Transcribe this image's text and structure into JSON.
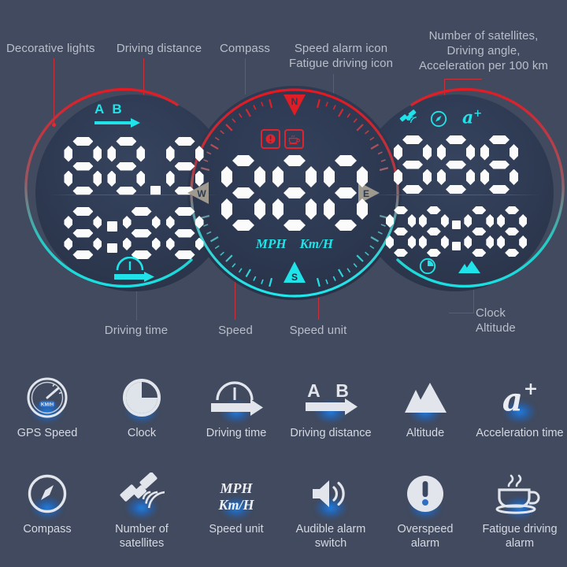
{
  "meta": {
    "background_color": "#414A5E",
    "accent_cyan": "#1FE3E8",
    "accent_red": "#E0242E",
    "label_color": "#B9BEC9",
    "digit_color": "#FBFBFB"
  },
  "callouts": {
    "decorative_lights": "Decorative lights",
    "driving_distance": "Driving distance",
    "compass": "Compass",
    "speed_alarm": "Speed alarm icon\nFatigue driving icon",
    "satellites_block": "Number of satellites,\nDriving angle,\nAcceleration per 100 km",
    "driving_time": "Driving time",
    "speed": "Speed",
    "speed_unit": "Speed unit",
    "clock_altitude": "Clock\nAltitude"
  },
  "left_display": {
    "top_icon_label": "A B",
    "top_value": "88.8",
    "bottom_value": "8:88",
    "bottom_icon_name": "driving-time-icon"
  },
  "center_display": {
    "speed_value": "888",
    "unit_mph": "MPH",
    "unit_kmh": "Km/H",
    "compass_points": [
      "N",
      "E",
      "S",
      "W"
    ],
    "alarm_icons": [
      "overspeed-alarm-icon",
      "fatigue-driving-icon"
    ]
  },
  "right_display": {
    "top_icons": [
      "satellite-icon",
      "compass-icon",
      "acceleration-icon"
    ],
    "acceleration_label": "a",
    "acceleration_sup": "+",
    "top_value": "888",
    "bottom_value": "88:88",
    "bottom_icons": [
      "clock-icon",
      "altitude-icon"
    ]
  },
  "legend": {
    "row1": [
      {
        "icon": "gps-speed-icon",
        "label": "GPS Speed",
        "icon_text": "KM/H"
      },
      {
        "icon": "clock-icon",
        "label": "Clock"
      },
      {
        "icon": "driving-time-icon",
        "label": "Driving time"
      },
      {
        "icon": "driving-distance-icon",
        "label": "Driving distance",
        "icon_text": "A B"
      },
      {
        "icon": "altitude-icon",
        "label": "Altitude"
      },
      {
        "icon": "acceleration-time-icon",
        "label": "Acceleration time",
        "icon_text": "a",
        "icon_sup": "+"
      }
    ],
    "row2": [
      {
        "icon": "compass-icon",
        "label": "Compass"
      },
      {
        "icon": "satellite-icon",
        "label": "Number of\nsatellites"
      },
      {
        "icon": "speed-unit-icon",
        "label": "Speed unit",
        "icon_text": "MPH",
        "icon_text2": "Km/H"
      },
      {
        "icon": "audible-alarm-icon",
        "label": "Audible alarm\nswitch"
      },
      {
        "icon": "overspeed-alarm-icon",
        "label": "Overspeed\nalarm"
      },
      {
        "icon": "fatigue-driving-icon",
        "label": "Fatigue driving\nalarm"
      }
    ]
  }
}
